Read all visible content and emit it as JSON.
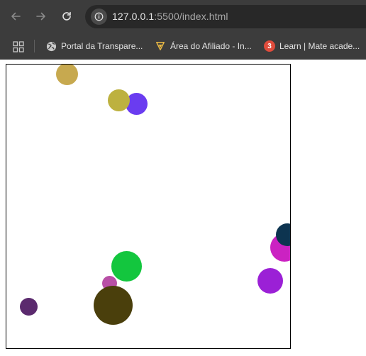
{
  "browser": {
    "url_host": "127.0.0.1",
    "url_rest": ":5500/index.html",
    "bookmarks": [
      {
        "label": "Portal da Transpare...",
        "icon": "globe-icon"
      },
      {
        "label": "Área do Afiliado - In...",
        "icon": "afiliado-logo-icon"
      },
      {
        "label": "Learn | Mate acade...",
        "icon": "notification-badge-icon",
        "badge": "3"
      }
    ]
  },
  "balls": [
    {
      "color": "#c7a94f"
    },
    {
      "color": "#6a3cf0"
    },
    {
      "color": "#bdb13f"
    },
    {
      "color": "#cb22c2"
    },
    {
      "color": "#0d3450"
    },
    {
      "color": "#9b20d6"
    },
    {
      "color": "#13c63e"
    },
    {
      "color": "#b84fa6"
    },
    {
      "color": "#4a3f0c"
    },
    {
      "color": "#5b2a6e"
    }
  ]
}
